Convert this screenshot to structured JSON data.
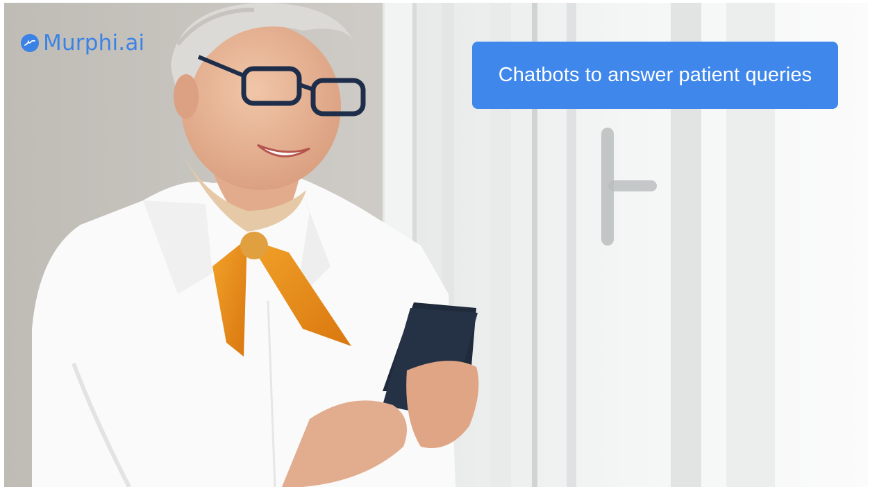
{
  "brand": {
    "name": "Murphi.ai",
    "logo_icon": "murphi-logo-icon",
    "color": "#3b82e6"
  },
  "banner": {
    "text": "Chatbots to answer patient queries",
    "background": "#3f87ea",
    "text_color": "#ffffff"
  }
}
